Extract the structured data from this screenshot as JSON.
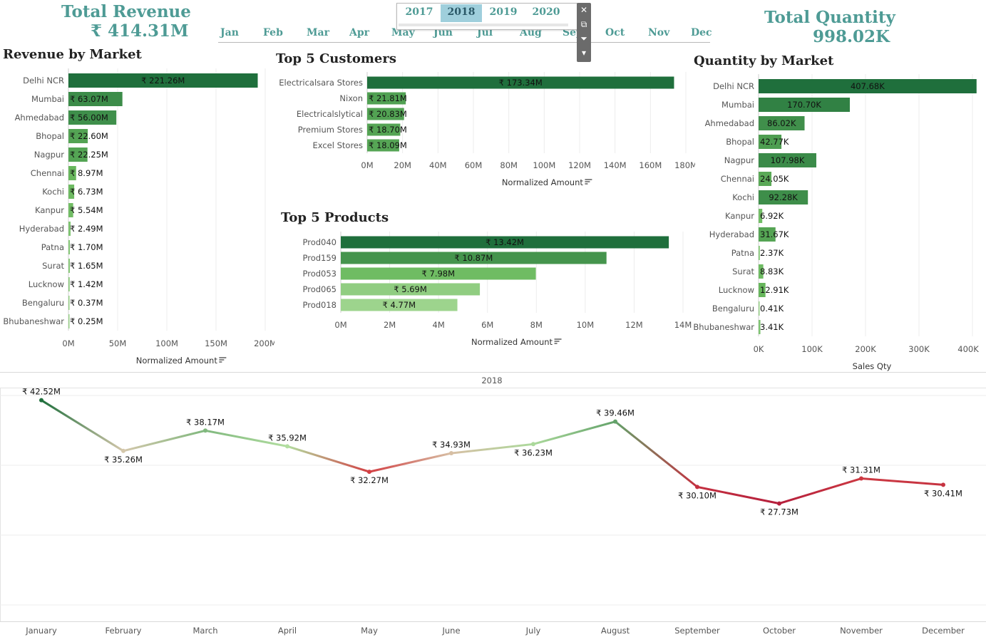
{
  "kpi": {
    "revenue_title": "Total Revenue",
    "revenue_value": "₹ 414.31M",
    "quantity_title": "Total Quantity",
    "quantity_value": "998.02K"
  },
  "filters": {
    "years": [
      "2017",
      "2018",
      "2019",
      "2020"
    ],
    "selected_year": "2018",
    "months": [
      "Jan",
      "Feb",
      "Mar",
      "Apr",
      "May",
      "Jun",
      "Jul",
      "Aug",
      "Sep",
      "Oct",
      "Nov",
      "Dec"
    ]
  },
  "toolbar": {
    "close": "✕",
    "popout": "⧉",
    "filter": "⏷",
    "menu": "▾"
  },
  "colors": {
    "dark_green": "#1f6f3c",
    "mid_green": "#6ab95e",
    "light_green": "#b3dfa1",
    "red": "#d64545",
    "crimson": "#b51f3c",
    "title_teal": "#4e9b95"
  },
  "chart_data": [
    {
      "id": "revenue_by_market",
      "type": "bar",
      "title": "Revenue by Market",
      "xlabel": "Normalized Amount",
      "xlim": [
        0,
        230
      ],
      "xticks": [
        "0M",
        "50M",
        "100M",
        "150M",
        "200M"
      ],
      "categories": [
        "Delhi NCR",
        "Mumbai",
        "Ahmedabad",
        "Bhopal",
        "Nagpur",
        "Chennai",
        "Kochi",
        "Kanpur",
        "Hyderabad",
        "Patna",
        "Surat",
        "Lucknow",
        "Bengaluru",
        "Bhubaneshwar"
      ],
      "values": [
        221.26,
        63.07,
        56.0,
        22.6,
        22.25,
        8.97,
        6.73,
        5.54,
        2.49,
        1.7,
        1.65,
        1.42,
        0.37,
        0.25
      ],
      "labels": [
        "₹ 221.26M",
        "₹ 63.07M",
        "₹ 56.00M",
        "₹ 22.60M",
        "₹ 22.25M",
        "₹ 8.97M",
        "₹ 6.73M",
        "₹ 5.54M",
        "₹ 2.49M",
        "₹ 1.70M",
        "₹ 1.65M",
        "₹ 1.42M",
        "₹ 0.37M",
        "₹ 0.25M"
      ]
    },
    {
      "id": "top5_customers",
      "type": "bar",
      "title": "Top 5 Customers",
      "xlabel": "Normalized Amount",
      "xlim": [
        0,
        180
      ],
      "xticks": [
        "0M",
        "20M",
        "40M",
        "60M",
        "80M",
        "100M",
        "120M",
        "140M",
        "160M",
        "180M"
      ],
      "categories": [
        "Electricalsara Stores",
        "Nixon",
        "Electricalslytical",
        "Premium Stores",
        "Excel Stores"
      ],
      "values": [
        173.34,
        21.81,
        20.83,
        18.7,
        18.09
      ],
      "labels": [
        "₹ 173.34M",
        "₹ 21.81M",
        "₹ 20.83M",
        "₹ 18.70M",
        "₹ 18.09M"
      ]
    },
    {
      "id": "top5_products",
      "type": "bar",
      "title": "Top 5 Products",
      "xlabel": "Normalized Amount",
      "xlim": [
        0,
        14
      ],
      "xticks": [
        "0M",
        "2M",
        "4M",
        "6M",
        "8M",
        "10M",
        "12M",
        "14M"
      ],
      "categories": [
        "Prod040",
        "Prod159",
        "Prod053",
        "Prod065",
        "Prod018"
      ],
      "values": [
        13.42,
        10.87,
        7.98,
        5.69,
        4.77
      ],
      "labels": [
        "₹ 13.42M",
        "₹ 10.87M",
        "₹ 7.98M",
        "₹ 5.69M",
        "₹ 4.77M"
      ]
    },
    {
      "id": "quantity_by_market",
      "type": "bar",
      "title": "Quantity by Market",
      "xlabel": "Sales Qty",
      "xlim": [
        0,
        400
      ],
      "xticks": [
        "0K",
        "100K",
        "200K",
        "300K",
        "400K"
      ],
      "categories": [
        "Delhi NCR",
        "Mumbai",
        "Ahmedabad",
        "Bhopal",
        "Nagpur",
        "Chennai",
        "Kochi",
        "Kanpur",
        "Hyderabad",
        "Patna",
        "Surat",
        "Lucknow",
        "Bengaluru",
        "Bhubaneshwar"
      ],
      "values": [
        407.68,
        170.7,
        86.02,
        42.77,
        107.98,
        24.05,
        92.28,
        6.92,
        31.67,
        2.37,
        8.83,
        12.91,
        0.41,
        3.41
      ],
      "labels": [
        "407.68K",
        "170.70K",
        "86.02K",
        "42.77K",
        "107.98K",
        "24.05K",
        "92.28K",
        "6.92K",
        "31.67K",
        "2.37K",
        "8.83K",
        "12.91K",
        "0.41K",
        "3.41K"
      ]
    },
    {
      "id": "monthly_revenue_trend",
      "type": "line",
      "title": "2018",
      "categories": [
        "January",
        "February",
        "March",
        "April",
        "May",
        "June",
        "July",
        "August",
        "September",
        "October",
        "November",
        "December"
      ],
      "values": [
        42.52,
        35.26,
        38.17,
        35.92,
        32.27,
        34.93,
        36.23,
        39.46,
        30.1,
        27.73,
        31.31,
        30.41
      ],
      "labels": [
        "₹ 42.52M",
        "₹ 35.26M",
        "₹ 38.17M",
        "₹ 35.92M",
        "₹ 32.27M",
        "₹ 34.93M",
        "₹ 36.23M",
        "₹ 39.46M",
        "₹ 30.10M",
        "₹ 27.73M",
        "₹ 31.31M",
        "₹ 30.41M"
      ],
      "grid": true
    }
  ]
}
